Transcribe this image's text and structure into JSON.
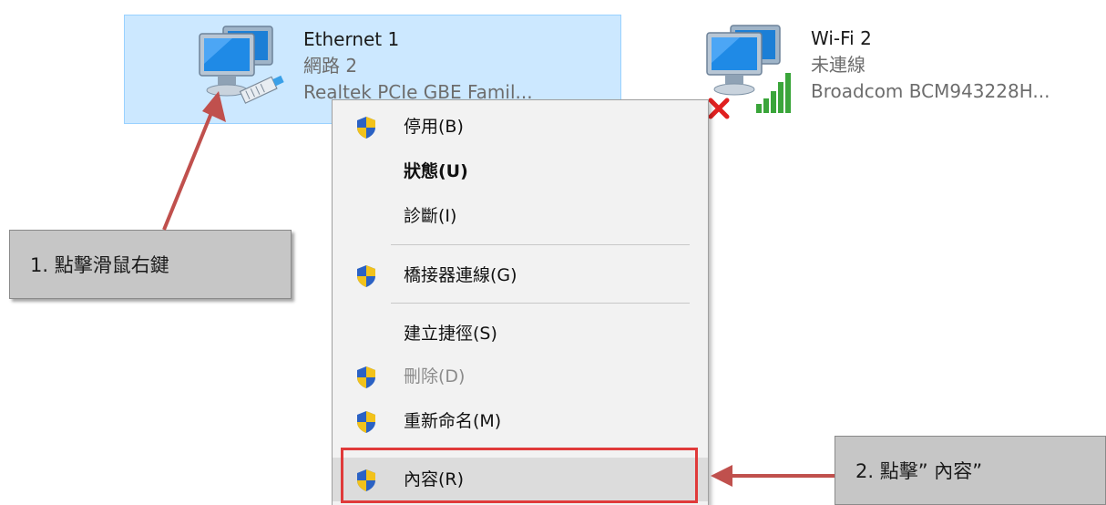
{
  "adapters": [
    {
      "name": "Ethernet 1",
      "status": "網路 2",
      "device": "Realtek PCIe GBE Famil...",
      "selected": true,
      "icon": "ethernet-network-icon"
    },
    {
      "name": "Wi-Fi 2",
      "status": "未連線",
      "device": "Broadcom BCM943228H...",
      "selected": false,
      "icon": "wifi-network-icon",
      "overlay_icons": [
        "disconnected-x-icon",
        "signal-bars-icon"
      ]
    }
  ],
  "context_menu": {
    "items": [
      {
        "label": "停用(B)",
        "shield": true,
        "bold": false,
        "disabled": false
      },
      {
        "label": "狀態(U)",
        "shield": false,
        "bold": true,
        "disabled": false
      },
      {
        "label": "診斷(I)",
        "shield": false,
        "bold": false,
        "disabled": false
      },
      {
        "label": "橋接器連線(G)",
        "shield": true,
        "bold": false,
        "disabled": false
      },
      {
        "label": "建立捷徑(S)",
        "shield": false,
        "bold": false,
        "disabled": false
      },
      {
        "label": "刪除(D)",
        "shield": true,
        "bold": false,
        "disabled": true
      },
      {
        "label": "重新命名(M)",
        "shield": true,
        "bold": false,
        "disabled": false
      },
      {
        "label": "內容(R)",
        "shield": true,
        "bold": false,
        "disabled": false,
        "hovered": true
      }
    ]
  },
  "annotations": {
    "step1": "1.   點擊滑鼠右鍵",
    "step2": "2.   點擊”  內容”"
  },
  "colors": {
    "selection_bg": "#cce8ff",
    "selection_border": "#99d1ff",
    "highlight_red": "#e03a3a",
    "arrow_red": "#c0504d",
    "callout_bg": "#c6c6c6",
    "shield_blue": "#2b62c4",
    "shield_yellow": "#f2c21b"
  }
}
